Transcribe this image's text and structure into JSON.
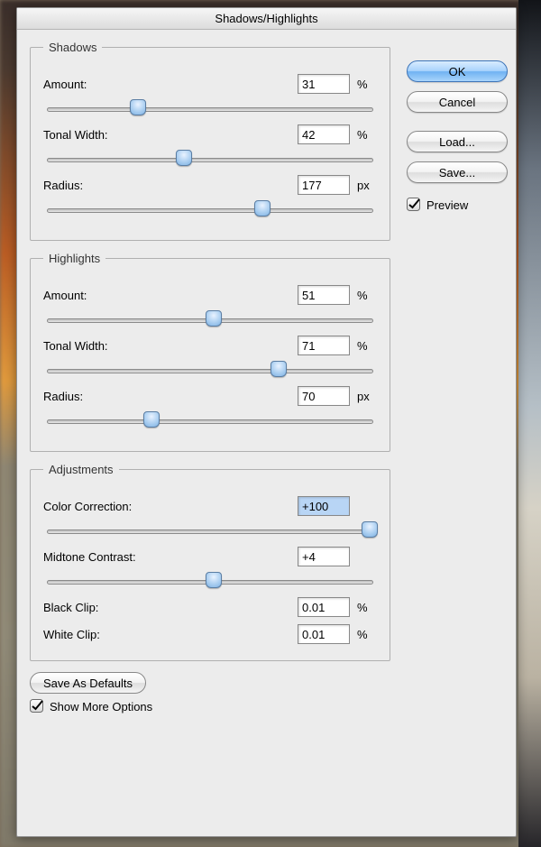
{
  "dialog": {
    "title": "Shadows/Highlights"
  },
  "shadows": {
    "legend": "Shadows",
    "amount": {
      "label": "Amount:",
      "value": "31",
      "unit": "%",
      "pct": 28
    },
    "tonal_width": {
      "label": "Tonal Width:",
      "value": "42",
      "unit": "%",
      "pct": 42
    },
    "radius": {
      "label": "Radius:",
      "value": "177",
      "unit": "px",
      "pct": 66
    }
  },
  "highlights": {
    "legend": "Highlights",
    "amount": {
      "label": "Amount:",
      "value": "51",
      "unit": "%",
      "pct": 51
    },
    "tonal_width": {
      "label": "Tonal Width:",
      "value": "71",
      "unit": "%",
      "pct": 71
    },
    "radius": {
      "label": "Radius:",
      "value": "70",
      "unit": "px",
      "pct": 32
    }
  },
  "adjustments": {
    "legend": "Adjustments",
    "color_correction": {
      "label": "Color Correction:",
      "value": "+100",
      "pct": 99,
      "selected": true
    },
    "midtone_contrast": {
      "label": "Midtone Contrast:",
      "value": "+4",
      "pct": 51
    },
    "black_clip": {
      "label": "Black Clip:",
      "value": "0.01",
      "unit": "%"
    },
    "white_clip": {
      "label": "White Clip:",
      "value": "0.01",
      "unit": "%"
    }
  },
  "buttons": {
    "ok": "OK",
    "cancel": "Cancel",
    "load": "Load...",
    "save": "Save...",
    "save_defaults": "Save As Defaults"
  },
  "checks": {
    "preview": {
      "label": "Preview",
      "checked": true
    },
    "show_more": {
      "label": "Show More Options",
      "checked": true
    }
  }
}
